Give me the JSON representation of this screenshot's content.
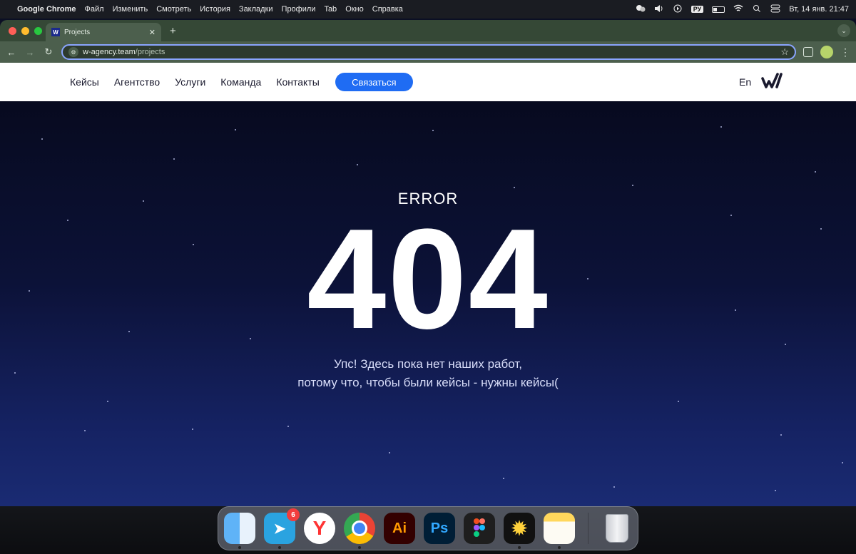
{
  "menubar": {
    "app_name": "Google Chrome",
    "items": [
      "Файл",
      "Изменить",
      "Смотреть",
      "История",
      "Закладки",
      "Профили",
      "Tab",
      "Окно",
      "Справка"
    ],
    "input_source": "РУ",
    "datetime": "Вт, 14 янв.  21:47"
  },
  "browser": {
    "tab_title": "Projects",
    "tab_favicon": "W",
    "url_host": "w-agency.team",
    "url_path": "/projects",
    "theme_color": "#4c5f4d"
  },
  "site": {
    "nav": [
      "Кейсы",
      "Агентство",
      "Услуги",
      "Команда",
      "Контакты"
    ],
    "cta": "Связаться",
    "lang": "En",
    "brand_blue": "#1f6cf3"
  },
  "error": {
    "label": "ERROR",
    "code": "404",
    "line1": "Упс! Здесь пока нет наших работ,",
    "line2": "потому что, чтобы были кейсы - нужны кейсы("
  },
  "dock": {
    "apps": [
      "finder-icon",
      "telegram-icon",
      "yandex-browser-icon",
      "chrome-icon",
      "illustrator-icon",
      "photoshop-icon",
      "figma-icon",
      "spark-icon",
      "notes-icon",
      "trash-icon"
    ],
    "telegram_badge": "6",
    "ai_label": "Ai",
    "ps_label": "Ps"
  }
}
